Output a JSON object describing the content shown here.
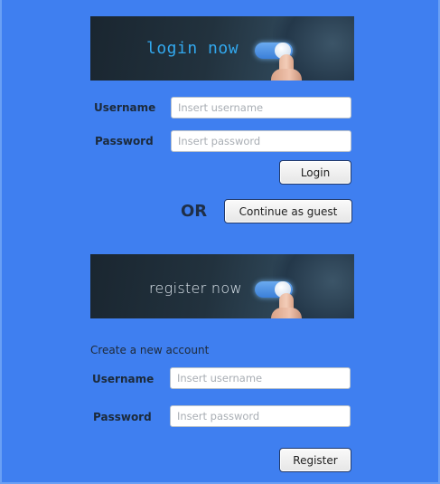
{
  "login": {
    "banner_text": "login now",
    "username_label": "Username",
    "username_placeholder": "Insert username",
    "password_label": "Password",
    "password_placeholder": "Insert password",
    "login_button": "Login"
  },
  "or_text": "OR",
  "guest_button": "Continue as guest",
  "register": {
    "banner_text": "register now",
    "caption": "Create a new account",
    "username_label": "Username",
    "username_placeholder": "Insert username",
    "password_label": "Password",
    "password_placeholder": "Insert password",
    "register_button": "Register"
  },
  "colors": {
    "background": "#3f7ff0",
    "login_banner_text": "#32a8ee"
  }
}
